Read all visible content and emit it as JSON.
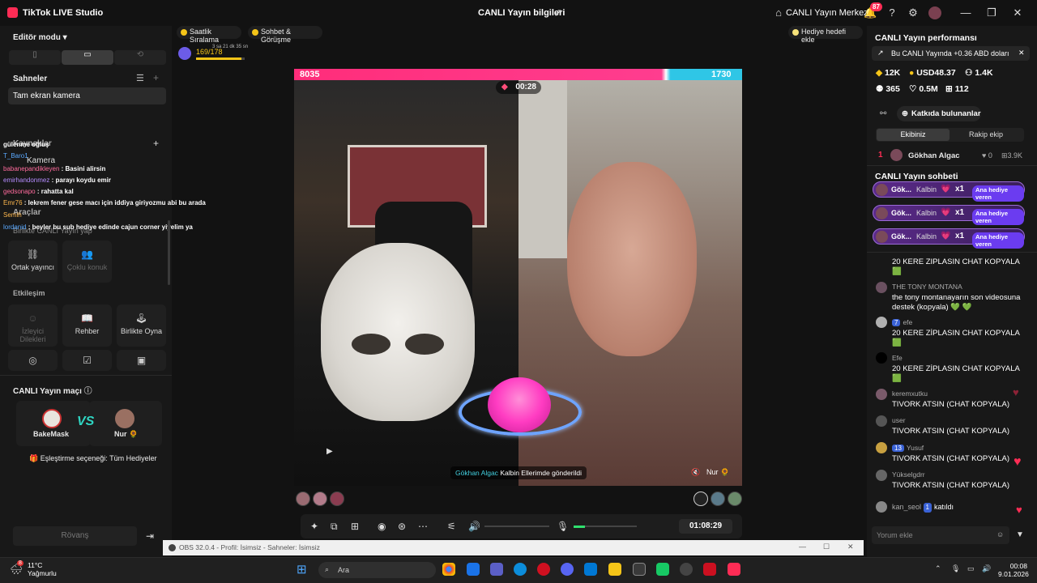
{
  "app": {
    "title": "TikTok LIVE Studio",
    "stream_info": "CANLI Yayın bilgileri",
    "live_center": "CANLI Yayın Merkezi",
    "notification_count": "87"
  },
  "left": {
    "editor_mode": "Editör modu",
    "scenes_title": "Sahneler",
    "scene_item": "Tam ekran kamera",
    "sources_title": "Kaynaklar",
    "source_item": "Kamera",
    "tools_title": "Araçlar",
    "tools_sub": "Birlikte CANLI Yayın yap",
    "tiles_row1": [
      {
        "label": "Ortak yayıncı",
        "dim": false
      },
      {
        "label": "Çoklu konuk",
        "dim": true
      }
    ],
    "interaction_title": "Etkileşim",
    "tiles_row2": [
      {
        "label": "İzleyici Dilekleri",
        "dim": true
      },
      {
        "label": "Rehber",
        "dim": false
      },
      {
        "label": "Birlikte Oyna",
        "dim": false
      }
    ],
    "match_title": "CANLI Yayın maçı",
    "player1": "BakeMask",
    "player2": "Nur 🌻",
    "vs": "VS",
    "match_option": "Eşleştirme seçeneği: Tüm Hediyeler",
    "rematch": "Rövanş"
  },
  "overlay_chat": [
    {
      "user": "",
      "text": "gülenme oğluş"
    },
    {
      "user": "T_Baro1",
      "text": ""
    },
    {
      "user": "babanepandikleyen",
      "text": ": Basini alirsin"
    },
    {
      "user": "emirhandonmez",
      "text": ": parayı koydu emir"
    },
    {
      "user": "gedsonapo",
      "text": ": rahatta kal"
    },
    {
      "user": "Emr76",
      "text": ": lekrem fener gese macı için iddiya giriyozmu abi bu arada"
    },
    {
      "user": "Semih",
      "text": ""
    },
    {
      "user": "lordanid",
      "text": ": beyler bu sub hediye edinde cajun corner yiyelim ya"
    }
  ],
  "center": {
    "pill_ranking": "Saatlik Sıralama",
    "pill_chat": "Sohbet & Görüşme",
    "goal_btn": "Hediye hedefi ekle",
    "level": "169/178",
    "level_time": "3 sa 21 dk 35 sn",
    "score_left": "8035",
    "score_right": "1730",
    "timer": "00:28",
    "gift_user": "Gökhan Algac",
    "gift_text": "Kalbin Ellerimde gönderildi",
    "nur_tag": "Nur 🌻",
    "elapsed": "01:08:29"
  },
  "obs": {
    "title": "OBS 32.0.4 - Profil: İsimsiz - Sahneler: İsimsiz"
  },
  "right": {
    "perf_title": "CANLI Yayın performansı",
    "perf_banner": "Bu CANLI Yayında +0.36 ABD doları",
    "stats": [
      {
        "icon": "coin-icon",
        "value": "12K"
      },
      {
        "icon": "dollar-icon",
        "value": "USD48.37"
      },
      {
        "icon": "users-icon",
        "value": "1.4K"
      },
      {
        "icon": "viewers-icon",
        "value": "365"
      },
      {
        "icon": "heart-icon",
        "value": "0.5M"
      },
      {
        "icon": "gift-icon",
        "value": "112"
      }
    ],
    "contributors_btn": "Katkıda bulunanlar",
    "tab_us": "Ekibiniz",
    "tab_rival": "Rakip ekip",
    "rank_num": "1",
    "rank_user": "Gökhan Algac",
    "rank_likes": "0",
    "rank_gifts": "3.9K",
    "chat_title": "CANLI Yayın sohbeti",
    "gift_rows": [
      {
        "user": "Gök...",
        "gift": "Kalbin",
        "count": "x1",
        "badge": "Ana hediye veren"
      },
      {
        "user": "Gök...",
        "gift": "Kalbin",
        "count": "x1",
        "badge": "Ana hediye veren"
      },
      {
        "user": "Gök...",
        "gift": "Kalbin",
        "count": "x1",
        "badge": "Ana hediye veren"
      }
    ],
    "comments": [
      {
        "user": "",
        "level": "",
        "text": "20 KERE ZIPLASIN CHAT KOPYALA 🟩"
      },
      {
        "user": "THE TONY MONTANA",
        "level": "",
        "text": "the tony montanayarın son videosuna destek (kopyala) 💚 💚"
      },
      {
        "user": "efe",
        "level": "7",
        "text": "20 KERE ZİPLASIN CHAT KOPYALA 🟩"
      },
      {
        "user": "Efe",
        "level": "",
        "text": "20 KERE ZİPLASIN CHAT KOPYALA 🟩"
      },
      {
        "user": "keremxutku",
        "level": "",
        "text": "TIVORK ATSIN (CHAT KOPYALA)"
      },
      {
        "user": "user",
        "level": "",
        "text": "TIVORK ATSIN (CHAT KOPYALA)"
      },
      {
        "user": "Yusuf",
        "level": "13",
        "text": "TIVORK ATSIN (CHAT KOPYALA)"
      },
      {
        "user": "Yükselgdrr",
        "level": "",
        "text": "TIVORK ATSIN (CHAT KOPYALA)"
      }
    ],
    "joined_user": "kan_seol",
    "joined_level": "1",
    "joined_text": "katıldı",
    "comment_placeholder": "Yorum ekle"
  },
  "taskbar": {
    "weather_temp": "11°C",
    "weather_desc": "Yağmurlu",
    "weather_badge": "8",
    "search": "Ara",
    "time": "00:08",
    "date": "9.01.2026"
  }
}
